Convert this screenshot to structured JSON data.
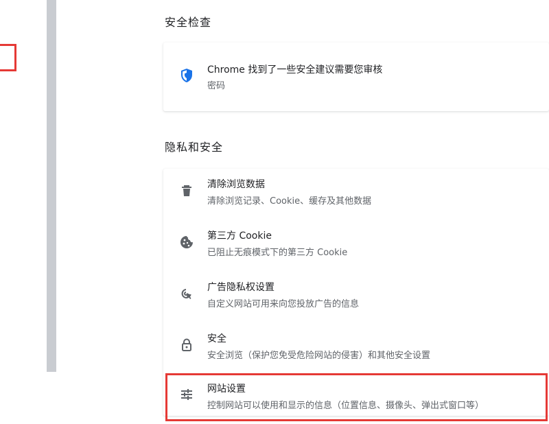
{
  "colors": {
    "highlight": "#e53935",
    "shield_blue": "#1a73e8",
    "icon_gray": "#5f6368",
    "text_primary": "#202124",
    "text_secondary": "#5f6368"
  },
  "safety_check": {
    "section_title": "安全检查",
    "item": {
      "icon": "shield-icon",
      "title": "Chrome 找到了一些安全建议需要您审核",
      "subtitle": "密码"
    }
  },
  "privacy": {
    "section_title": "隐私和安全",
    "items": [
      {
        "icon": "trash-icon",
        "title": "清除浏览数据",
        "subtitle": "清除浏览记录、Cookie、缓存及其他数据"
      },
      {
        "icon": "cookie-icon",
        "title": "第三方 Cookie",
        "subtitle": "已阻止无痕模式下的第三方 Cookie"
      },
      {
        "icon": "ad-privacy-icon",
        "title": "广告隐私权设置",
        "subtitle": "自定义网站可用来向您投放广告的信息"
      },
      {
        "icon": "lock-icon",
        "title": "安全",
        "subtitle": "安全浏览（保护您免受危险网站的侵害）和其他安全设置"
      },
      {
        "icon": "tune-icon",
        "title": "网站设置",
        "subtitle": "控制网站可以使用和显示的信息（位置信息、摄像头、弹出式窗口等）"
      }
    ]
  }
}
